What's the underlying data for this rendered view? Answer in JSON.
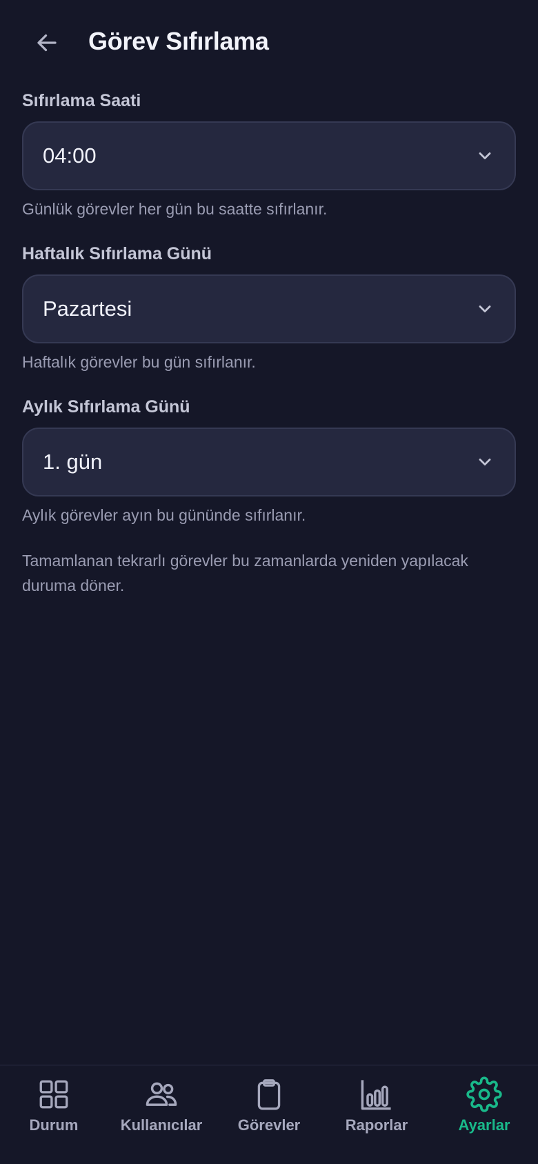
{
  "header": {
    "title": "Görev Sıfırlama",
    "back_icon": "arrow-left-icon"
  },
  "fields": [
    {
      "label": "Sıfırlama Saati",
      "value": "04:00",
      "hint": "Günlük görevler her gün bu saatte sıfırlanır."
    },
    {
      "label": "Haftalık Sıfırlama Günü",
      "value": "Pazartesi",
      "hint": "Haftalık görevler bu gün sıfırlanır."
    },
    {
      "label": "Aylık Sıfırlama Günü",
      "value": "1. gün",
      "hint": "Aylık görevler ayın bu gününde sıfırlanır."
    }
  ],
  "note": "Tamamlanan tekrarlı görevler bu zamanlarda yeniden yapılacak duruma döner.",
  "nav": {
    "items": [
      {
        "label": "Durum",
        "icon": "grid-icon"
      },
      {
        "label": "Kullanıcılar",
        "icon": "users-icon"
      },
      {
        "label": "Görevler",
        "icon": "clipboard-icon"
      },
      {
        "label": "Raporlar",
        "icon": "bar-chart-icon"
      },
      {
        "label": "Ayarlar",
        "icon": "gear-icon",
        "active": true
      }
    ]
  },
  "colors": {
    "background": "#151728",
    "field_bg": "#25283f",
    "accent": "#19b98a",
    "muted_text": "#9a9cb2"
  }
}
